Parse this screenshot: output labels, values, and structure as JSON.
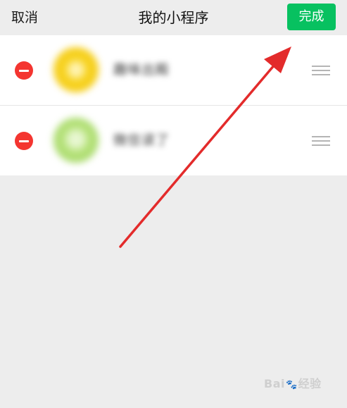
{
  "header": {
    "cancel_label": "取消",
    "title": "我的小程序",
    "done_label": "完成"
  },
  "miniprograms": [
    {
      "name": "趣味出殿",
      "icon": "yellow-app-icon",
      "color": "#f4c915"
    },
    {
      "name": "微信读了",
      "icon": "green-app-icon",
      "color": "#9dd35e"
    }
  ],
  "colors": {
    "accent": "#07c160",
    "remove": "#f43530",
    "annotation_arrow": "#e32b2b",
    "background": "#ededed"
  },
  "watermark": {
    "text_left": "Bai",
    "paw": "🐾",
    "text_right": "经验"
  }
}
